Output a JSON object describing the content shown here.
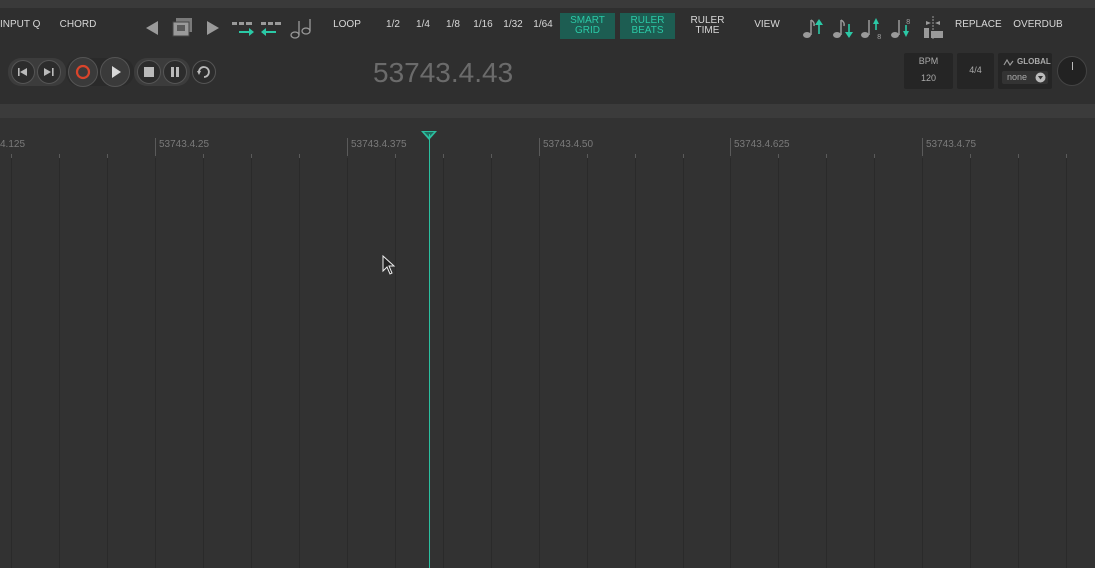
{
  "toolbar": {
    "input_q": "INPUT Q",
    "chord": "CHORD",
    "loop": "LOOP",
    "div_half": "1/2",
    "div_quarter": "1/4",
    "div_eighth": "1/8",
    "div_16": "1/16",
    "div_32": "1/32",
    "div_64": "1/64",
    "smart_grid_1": "SMART",
    "smart_grid_2": "GRID",
    "ruler_beats_1": "RULER",
    "ruler_beats_2": "BEATS",
    "ruler_time_1": "RULER",
    "ruler_time_2": "TIME",
    "view": "VIEW",
    "replace": "REPLACE",
    "overdub": "OVERDUB",
    "accent_color": "#2bc9a6",
    "active_bg": "#1d5d52"
  },
  "transport": {
    "timecode": "53743.4.43",
    "bpm_label": "BPM",
    "bpm_value": "120",
    "time_signature": "4/4",
    "global_label": "GLOBAL",
    "global_value": "none",
    "record_color": "#d9442b"
  },
  "ruler": {
    "labels": [
      "4.125",
      "53743.4.25",
      "53743.4.375",
      "53743.4.50",
      "53743.4.625",
      "53743.4.75"
    ],
    "playhead_color": "#2bbfa0"
  }
}
